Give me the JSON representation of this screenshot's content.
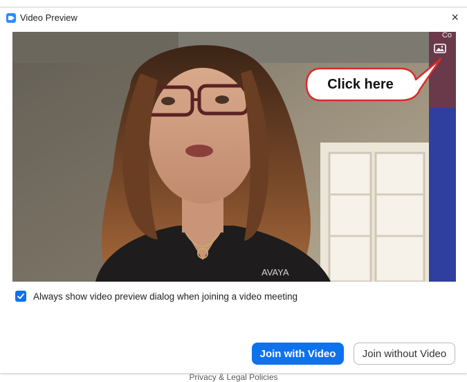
{
  "window": {
    "title": "Video Preview",
    "close_glyph": "×",
    "app_icon": "zoom-icon"
  },
  "video": {
    "corner_label": "Co",
    "background_button_icon": "image-icon",
    "callout_text": "Click here",
    "shirt_text": "AVAYA"
  },
  "options": {
    "always_show_label": "Always show video preview dialog when joining a video meeting",
    "always_show_checked": true
  },
  "buttons": {
    "join_with_video": "Join with Video",
    "join_without_video": "Join without Video"
  },
  "footer": {
    "link_text": "Privacy & Legal Policies"
  },
  "colors": {
    "accent": "#0e72ed",
    "callout_border": "#d92a2a"
  }
}
